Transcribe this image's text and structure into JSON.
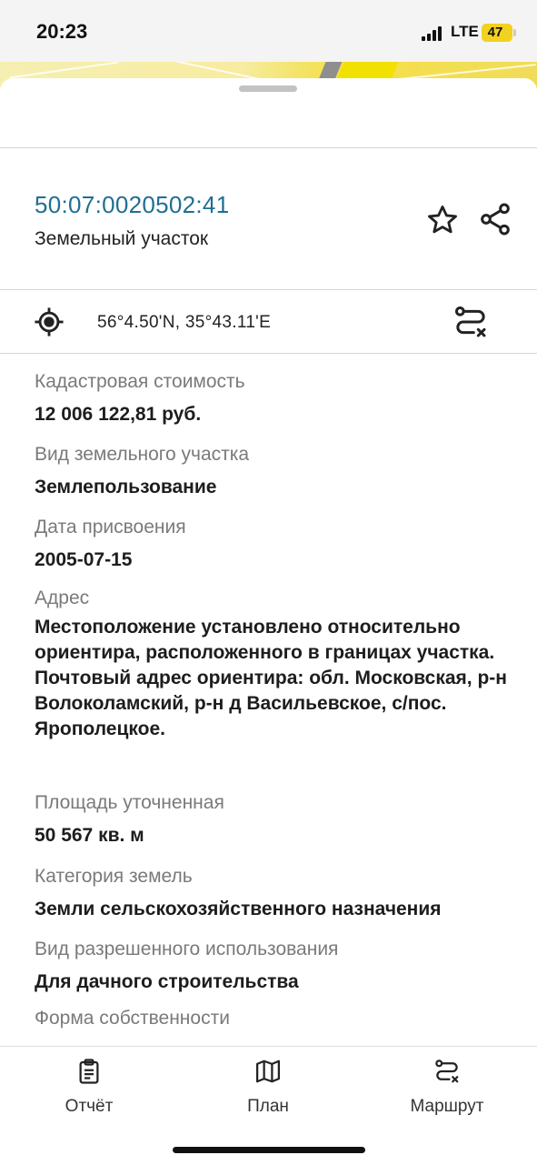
{
  "status_bar": {
    "time": "20:23",
    "network": "LTE",
    "battery": "47"
  },
  "sheet": {
    "cadastral_number": "50:07:0020502:41",
    "object_type": "Земельный участок",
    "coordinates": "56°4.50'N, 35°43.11'E"
  },
  "fields": [
    {
      "label": "Кадастровая стоимость",
      "value": "12 006 122,81 руб."
    },
    {
      "label": "Вид земельного участка",
      "value": "Землепользование"
    },
    {
      "label": "Дата присвоения",
      "value": "2005-07-15"
    },
    {
      "label": "Адрес",
      "value": "Местоположение установлено относительно ориентира, расположенного в границах участка. Почтовый адрес ориентира: обл. Московская, р-н Волоколамский, р-н д Васильевское, с/пос. Ярополецкое."
    },
    {
      "label": "Площадь уточненная",
      "value": "50 567 кв. м"
    },
    {
      "label": "Категория земель",
      "value": "Земли сельскохозяйственного назначения"
    },
    {
      "label": "Вид разрешенного использования",
      "value": "Для дачного строительства"
    },
    {
      "label": "Форма собственности",
      "value": ""
    }
  ],
  "tabs": [
    {
      "label": "Отчёт",
      "icon": "report-icon"
    },
    {
      "label": "План",
      "icon": "map-icon"
    },
    {
      "label": "Маршрут",
      "icon": "route-icon"
    }
  ],
  "colors": {
    "link": "#1f6f93",
    "label": "#7a7a7a",
    "battery": "#f2d21e",
    "map": "#f6e04a"
  }
}
